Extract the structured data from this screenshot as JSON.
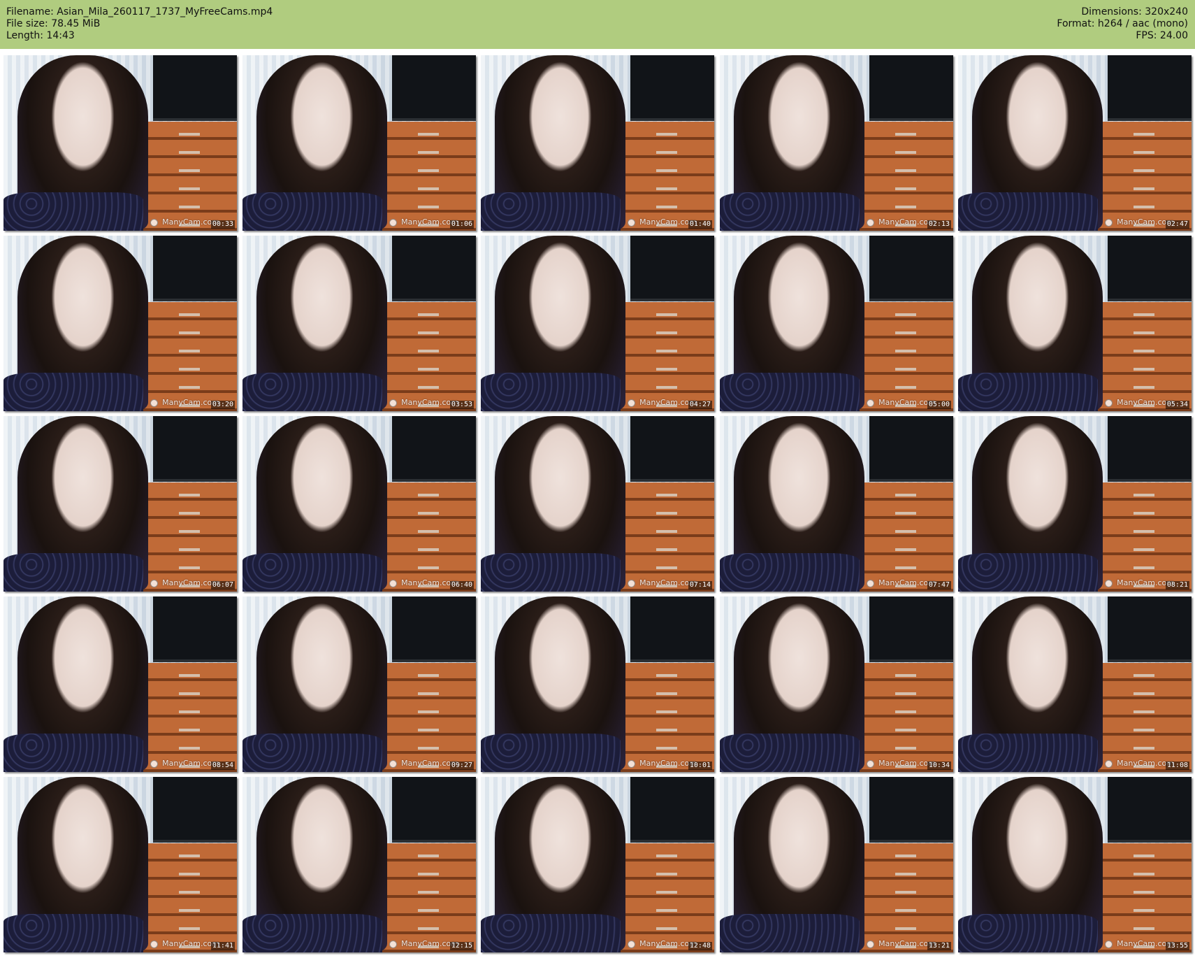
{
  "header": {
    "left": [
      "Filename: Asian_Mila_260117_1737_MyFreeCams.mp4",
      "File size: 78.45 MiB",
      "Length: 14:43"
    ],
    "right": [
      "Dimensions: 320x240",
      "Format: h264 / aac (mono)",
      "FPS: 24.00"
    ],
    "bg_color": "#b0cc7f"
  },
  "watermark": "ManyCam.com",
  "thumbnails": [
    "00:33",
    "01:06",
    "01:40",
    "02:13",
    "02:47",
    "03:20",
    "03:53",
    "04:27",
    "05:00",
    "05:34",
    "06:07",
    "06:40",
    "07:14",
    "07:47",
    "08:21",
    "08:54",
    "09:27",
    "10:01",
    "10:34",
    "11:08",
    "11:41",
    "12:15",
    "12:48",
    "13:21",
    "13:55"
  ]
}
